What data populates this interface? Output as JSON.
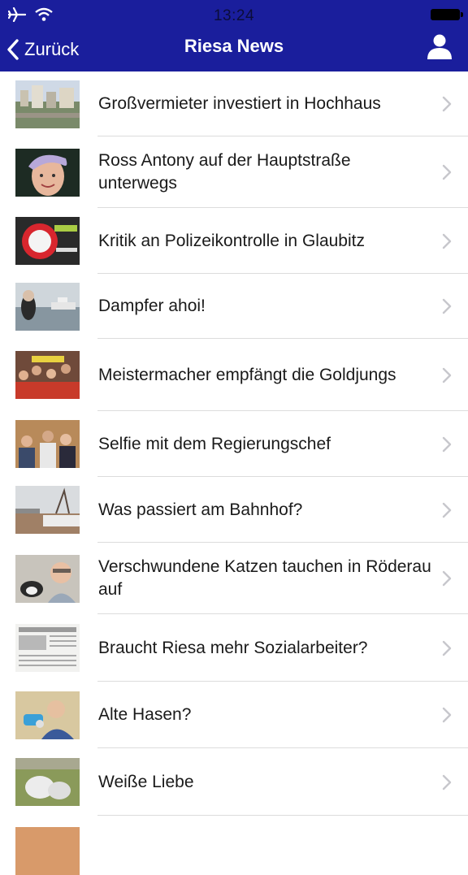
{
  "status_bar": {
    "time": "13:24"
  },
  "nav": {
    "back_label": "Zurück",
    "title": "Riesa News"
  },
  "colors": {
    "nav_background": "#1a1e9c",
    "text": "#1a1a1a",
    "chevron": "#c7c7cc"
  },
  "articles": [
    {
      "title": "Großvermieter investiert in Hochhaus",
      "thumb": "city-skyline"
    },
    {
      "title": "Ross Antony auf der Hauptstraße unterwegs",
      "thumb": "portrait-blond"
    },
    {
      "title": "Kritik an Polizeikontrolle in Glaubitz",
      "thumb": "police-sign"
    },
    {
      "title": "Dampfer ahoi!",
      "thumb": "river-steamer"
    },
    {
      "title": "Meistermacher empfängt die Goldjungs",
      "thumb": "crowd"
    },
    {
      "title": "Selfie mit dem Regierungschef",
      "thumb": "selfie-group"
    },
    {
      "title": "Was passiert am Bahnhof?",
      "thumb": "winter-station"
    },
    {
      "title": "Verschwundene Katzen tauchen in Röderau auf",
      "thumb": "man-with-cat"
    },
    {
      "title": "Braucht Riesa mehr Sozialarbeiter?",
      "thumb": "newspaper"
    },
    {
      "title": "Alte Hasen?",
      "thumb": "person-with-toy"
    },
    {
      "title": "Weiße Liebe",
      "thumb": "sacks-on-grass"
    },
    {
      "title": "",
      "thumb": "partial"
    }
  ]
}
